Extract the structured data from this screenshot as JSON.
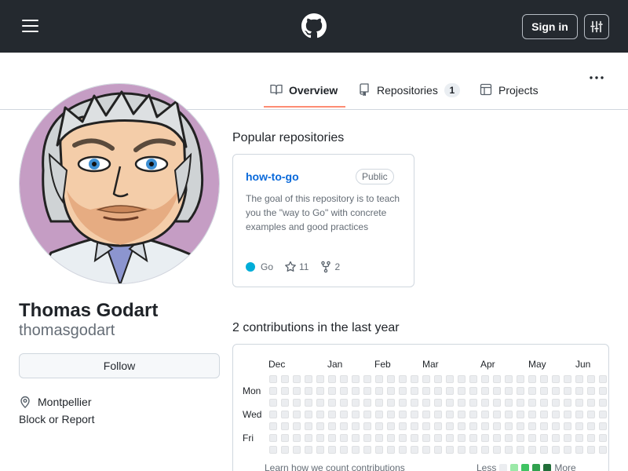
{
  "header": {
    "menu_icon": "hamburger-icon",
    "logo_icon": "github-mark-icon",
    "signin_label": "Sign in",
    "settings_icon": "sliders-icon"
  },
  "tabs": [
    {
      "label": "Overview",
      "icon": "book-icon",
      "selected": true
    },
    {
      "label": "Repositories",
      "icon": "repo-icon",
      "count": "1"
    },
    {
      "label": "Projects",
      "icon": "table-icon"
    }
  ],
  "more_icon": "kebab-horizontal-icon",
  "profile": {
    "fullname": "Thomas Godart",
    "username": "thomasgodart",
    "follow_label": "Follow",
    "location": "Montpellier",
    "location_icon": "location-pin-icon",
    "block_label": "Block or Report"
  },
  "popular": {
    "title": "Popular repositories",
    "repos": [
      {
        "name": "how-to-go",
        "visibility": "Public",
        "description": "The goal of this repository is to teach you the \"way to Go\" with concrete examples and good practices",
        "language": "Go",
        "language_color": "#00add8",
        "stars": "11",
        "forks": "2"
      }
    ]
  },
  "contributions": {
    "title": "2 contributions in the last year",
    "months": [
      "Dec",
      "Jan",
      "Feb",
      "Mar",
      "Apr",
      "May",
      "Jun"
    ],
    "days": [
      "Mon",
      "Wed",
      "Fri"
    ],
    "learn_label": "Learn how we count contributions",
    "legend_less": "Less",
    "legend_more": "More",
    "legend_colors": [
      "#ebedf0",
      "#9be9a8",
      "#40c463",
      "#30a14e",
      "#216e39"
    ],
    "empty_color": "#ebedf0"
  }
}
